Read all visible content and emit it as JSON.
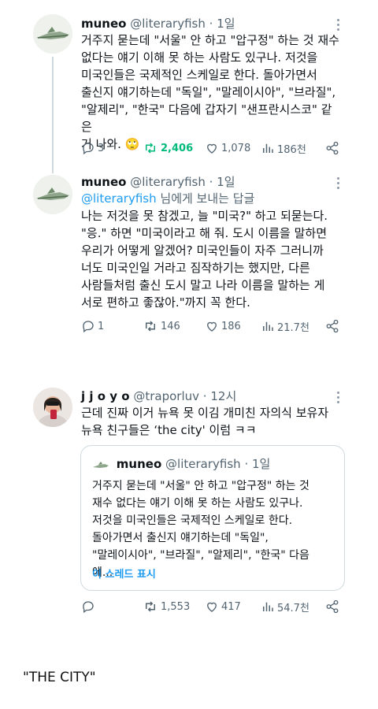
{
  "tweet1": {
    "display_name": "muneo",
    "handle": "@literaryfish",
    "dot": "·",
    "time": "1일",
    "lines": [
      "거주지 묻는데 \"서울\" 안 하고 \"압구정\" 하는 것 재수",
      "없다는 얘기 이해 못 하는 사람도 있구나. 저것을",
      "미국인들은 국제적인 스케일로 한다. 돌아가면서",
      "출신지 얘기하는데 \"독일\", \"말레이시아\", \"브라질\",",
      "\"알제리\", \"한국\" 다음에 갑자기 \"샌프란시스코\" 같은",
      "거 나와. 🙄"
    ],
    "replies": "3",
    "retweets": "2,406",
    "likes": "1,078",
    "views": "186천"
  },
  "tweet2": {
    "display_name": "muneo",
    "handle": "@literaryfish",
    "dot": "·",
    "time": "1일",
    "reply_mention": "@literaryfish",
    "reply_suffix": " 님에게 보내는 답글",
    "lines": [
      "나는 저것을 못 참겠고, 늘 \"미국?\" 하고 되묻는다.",
      "\"응.\" 하면 \"미국이라고 해 줘. 도시 이름을 말하면",
      "우리가 어떻게 알겠어? 미국인들이 자주 그러니까",
      "너도 미국인일 거라고 짐작하기는 했지만, 다른",
      "사람들처럼 출신 도시 말고 나라 이름을 말하는 게",
      "서로 편하고 좋잖아.\"까지 꼭 한다."
    ],
    "replies": "1",
    "retweets": "146",
    "likes": "186",
    "views": "21.7천"
  },
  "tweet3": {
    "display_name": "j j o y o",
    "handle": "@traporluv",
    "dot": "·",
    "time": "12시",
    "lines": [
      "근데 진짜 이거 뉴욕 못 이김 개미친 자의식 보유자",
      "뉴욕 친구들은 ‘the city' 이럼 ㅋㅋ"
    ],
    "quote": {
      "display_name": "muneo",
      "handle": "@literaryfish",
      "dot": "·",
      "time": "1일",
      "lines": [
        "거주지 묻는데 \"서울\" 안 하고 \"압구정\" 하는 것",
        "재수 없다는 얘기 이해 못 하는 사람도 있구나.",
        "저것을 미국인들은 국제적인 스케일로 한다.",
        "돌아가면서 출신지 얘기하는데 \"독일\",",
        "\"말레이시아\", \"브라질\", \"알제리\", \"한국\" 다음에..."
      ],
      "show_thread": "이 스레드 표시"
    },
    "replies": "",
    "retweets": "1,553",
    "likes": "417",
    "views": "54.7천"
  },
  "caption": "\"THE CITY\"",
  "colors": {
    "accent": "#1d9bf0",
    "retweet": "#00ba7c",
    "muted": "#536471",
    "border": "#cfd9de"
  },
  "icons": [
    "reply-icon",
    "retweet-icon",
    "like-icon",
    "views-icon",
    "share-icon",
    "more-icon"
  ]
}
